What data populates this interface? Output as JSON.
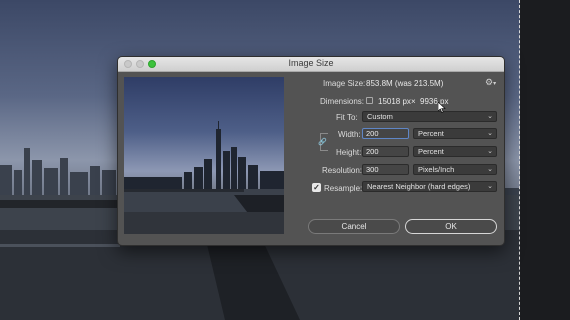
{
  "dialog": {
    "title": "Image Size",
    "image_size_label": "Image Size:",
    "image_size_value": "853.8M (was 213.5M)",
    "dimensions_label": "Dimensions:",
    "dimensions_width": "15018 px",
    "dimensions_sep": "×",
    "dimensions_height": "9936 px",
    "fit_to_label": "Fit To:",
    "fit_to_value": "Custom",
    "width_label": "Width:",
    "width_value": "200",
    "width_unit": "Percent",
    "height_label": "Height:",
    "height_value": "200",
    "height_unit": "Percent",
    "resolution_label": "Resolution:",
    "resolution_value": "300",
    "resolution_unit": "Pixels/Inch",
    "resample_label": "Resample:",
    "resample_checked": true,
    "resample_value": "Nearest Neighbor (hard edges)",
    "cancel_label": "Cancel",
    "ok_label": "OK"
  },
  "icons": {
    "close": "close-icon",
    "minimize": "minimize-icon",
    "maximize": "maximize-icon",
    "gear": "gear-icon",
    "dropdown": "chevron-down-icon",
    "check": "checkmark-icon",
    "link": "link-icon",
    "cursor": "arrow-cursor-icon"
  },
  "colors": {
    "dialog_bg": "#535353",
    "field_bg": "#454545",
    "focus_border": "#5f86c6",
    "zoom_green": "#3dc23d"
  }
}
